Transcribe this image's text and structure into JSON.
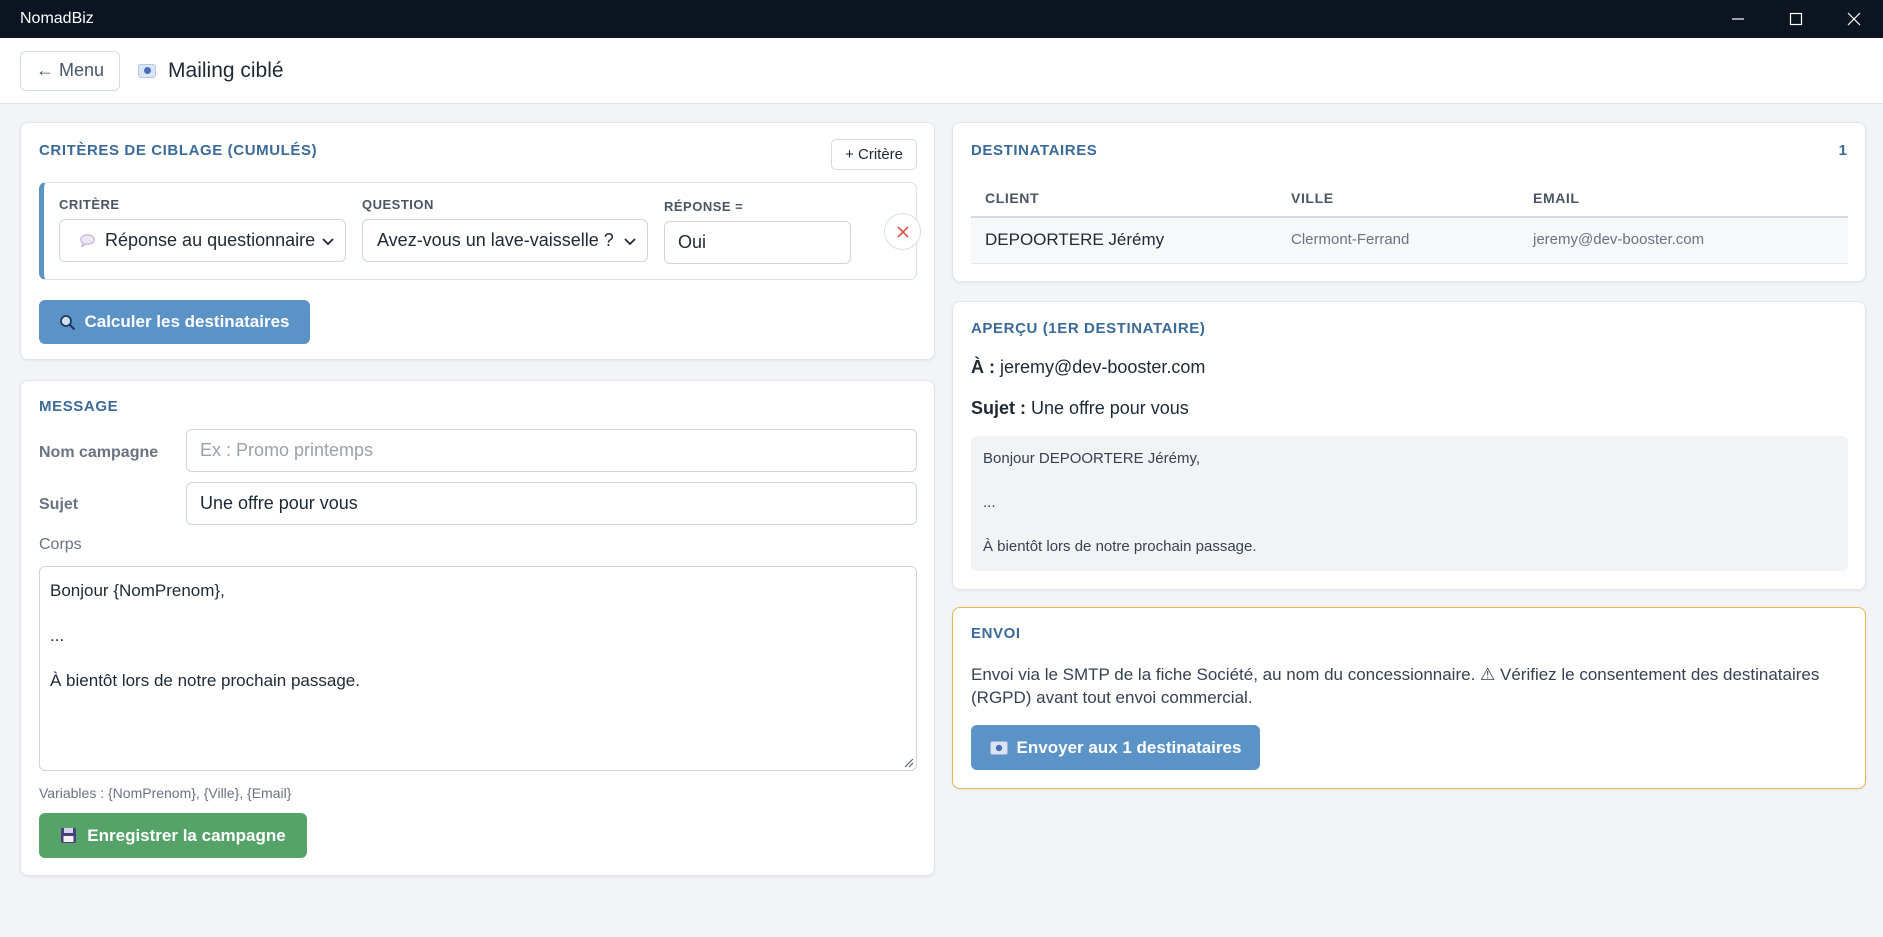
{
  "window": {
    "title": "NomadBiz"
  },
  "header": {
    "menu_label": "← Menu",
    "page_title": "Mailing ciblé"
  },
  "criteria": {
    "title": "Critères de ciblage (cumulés)",
    "add_label": "+ Critère",
    "criterion_label": "Critère",
    "question_label": "Question",
    "answer_label": "Réponse =",
    "criterion_value": "Réponse au questionnaire",
    "question_value": "Avez-vous un lave-vaisselle ?",
    "answer_value": "Oui",
    "calc_label": "Calculer les destinataires"
  },
  "message": {
    "title": "Message",
    "campaign_label": "Nom campagne",
    "campaign_placeholder": "Ex : Promo printemps",
    "subject_label": "Sujet",
    "subject_value": "Une offre pour vous",
    "body_label": "Corps",
    "body_lines": [
      "Bonjour {NomPrenom},",
      "...",
      "À bientôt lors de notre prochain passage."
    ],
    "variables_hint": "Variables : {NomPrenom}, {Ville}, {Email}",
    "save_label": "Enregistrer la campagne"
  },
  "recipients": {
    "title": "Destinataires",
    "count": "1",
    "columns": [
      "Client",
      "Ville",
      "Email"
    ],
    "rows": [
      {
        "client": "DEPOORTERE Jérémy",
        "ville": "Clermont-Ferrand",
        "email": "jeremy@dev-booster.com"
      }
    ]
  },
  "preview": {
    "title": "Aperçu (1er destinataire)",
    "to_label": "À :",
    "to_value": "jeremy@dev-booster.com",
    "subject_label": "Sujet :",
    "subject_value": "Une offre pour vous",
    "body_lines": [
      "Bonjour DEPOORTERE Jérémy,",
      "...",
      "À bientôt lors de notre prochain passage."
    ]
  },
  "send": {
    "title": "Envoi",
    "notice": "Envoi via le SMTP de la fiche Société, au nom du concessionnaire. ⚠ Vérifiez le consentement des destinataires (RGPD) avant tout envoi commercial.",
    "button_label": "Envoyer aux 1 destinataires"
  },
  "colors": {
    "primary": "#5b93c7",
    "success": "#56a36a",
    "heading": "#3b6a99",
    "warning_border": "#e8b64e",
    "titlebar": "#0b1420"
  }
}
